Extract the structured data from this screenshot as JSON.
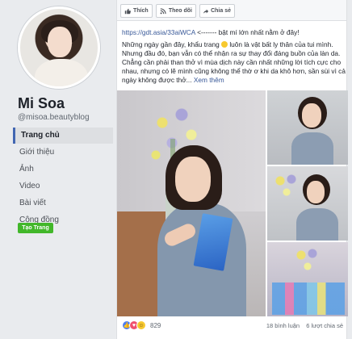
{
  "sidebar": {
    "page_name": "Mi Soa",
    "handle": "@misoa.beautyblog",
    "nav": [
      {
        "label": "Trang chủ",
        "active": true
      },
      {
        "label": "Giới thiệu",
        "active": false
      },
      {
        "label": "Ảnh",
        "active": false
      },
      {
        "label": "Video",
        "active": false
      },
      {
        "label": "Bài viết",
        "active": false
      },
      {
        "label": "Cộng đồng",
        "active": false
      }
    ],
    "create_page_label": "Tạo Trang"
  },
  "toolbar": {
    "like_label": "Thích",
    "follow_label": "Theo dõi",
    "share_label": "Chia sẻ"
  },
  "post": {
    "link_line_url": "https://gdt.asia/33aiWCA",
    "link_line_rest": " <------- bật mí lớn nhất nằm ở đây!",
    "para_1": "Những ngày gần đây, khẩu trang",
    "para_1b": " luôn là vật bất ly thân của tui mình. Nhưng đầu đó, bạn vẫn có thể nhận ra sự thay đổi đáng buồn của làn da. Chẳng cần phải than thở vì mùa dịch này cần nhất những lời tích cực cho nhau, nhưng có lẽ mình cũng không thể thờ ơ khi da khô hơn, sần sùi vì cả ngày không được thở...",
    "see_more": "Xem thêm"
  },
  "footer": {
    "reaction_count": "829",
    "comments": "18 bình luận",
    "shares": "6 lượt chia sẻ"
  },
  "colors": {
    "accent": "#4267b2",
    "link": "#385898",
    "create_button": "#42b72a"
  },
  "icons": {
    "like": "thumb-up-icon",
    "follow": "rss-icon",
    "share": "share-arrow-icon"
  }
}
